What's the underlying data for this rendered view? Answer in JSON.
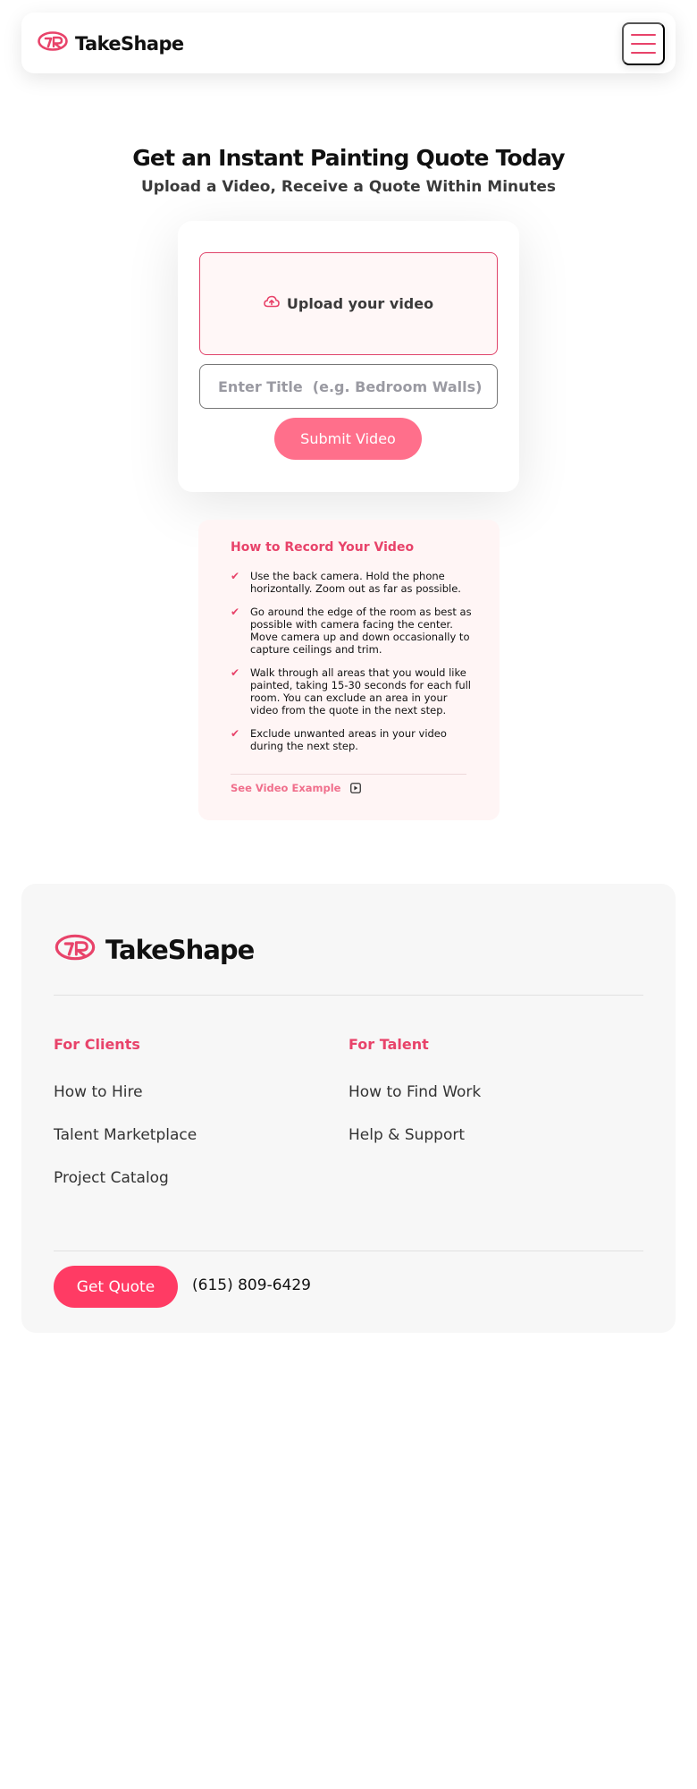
{
  "header": {
    "brand": "TakeShape",
    "menu_icon": "hamburger-icon"
  },
  "hero": {
    "title": "Get an Instant Painting Quote Today",
    "subtitle": "Upload a Video, Receive a Quote Within Minutes"
  },
  "upload": {
    "dropzone_label": "Upload your video",
    "dropzone_icon": "cloud-upload-icon",
    "title_placeholder": "Enter Title  (e.g. Bedroom Walls)",
    "title_value": "",
    "submit_label": "Submit Video"
  },
  "howto": {
    "title": "How to Record Your Video",
    "steps": [
      "Use the back camera. Hold the phone horizontally. Zoom out as far as possible.",
      "Go around the edge of the room as best as possible with camera facing the center. Move camera up and down occasionally to capture ceilings and trim.",
      "Walk through all areas that you would like painted, taking 15-30 seconds for each full room. You can exclude an area in your video from the quote in the next step.",
      "Exclude unwanted areas in your video during the next step."
    ],
    "check_icon": "check-icon",
    "example_label": "See Video Example",
    "example_icon": "play-icon"
  },
  "footer": {
    "brand": "TakeShape",
    "clients": {
      "heading": "For Clients",
      "links": [
        "How to Hire",
        "Talent Marketplace",
        "Project Catalog"
      ]
    },
    "talent": {
      "heading": "For Talent",
      "links": [
        "How to Find Work",
        "Help & Support"
      ]
    },
    "quote_label": "Get Quote",
    "phone": "(615) 809-6429"
  },
  "colors": {
    "accent": "#e8436a",
    "submit": "#ff6f8b",
    "cta": "#ff3b64",
    "panel_bg": "#fff5f5",
    "footer_bg": "#f7f7f7"
  }
}
